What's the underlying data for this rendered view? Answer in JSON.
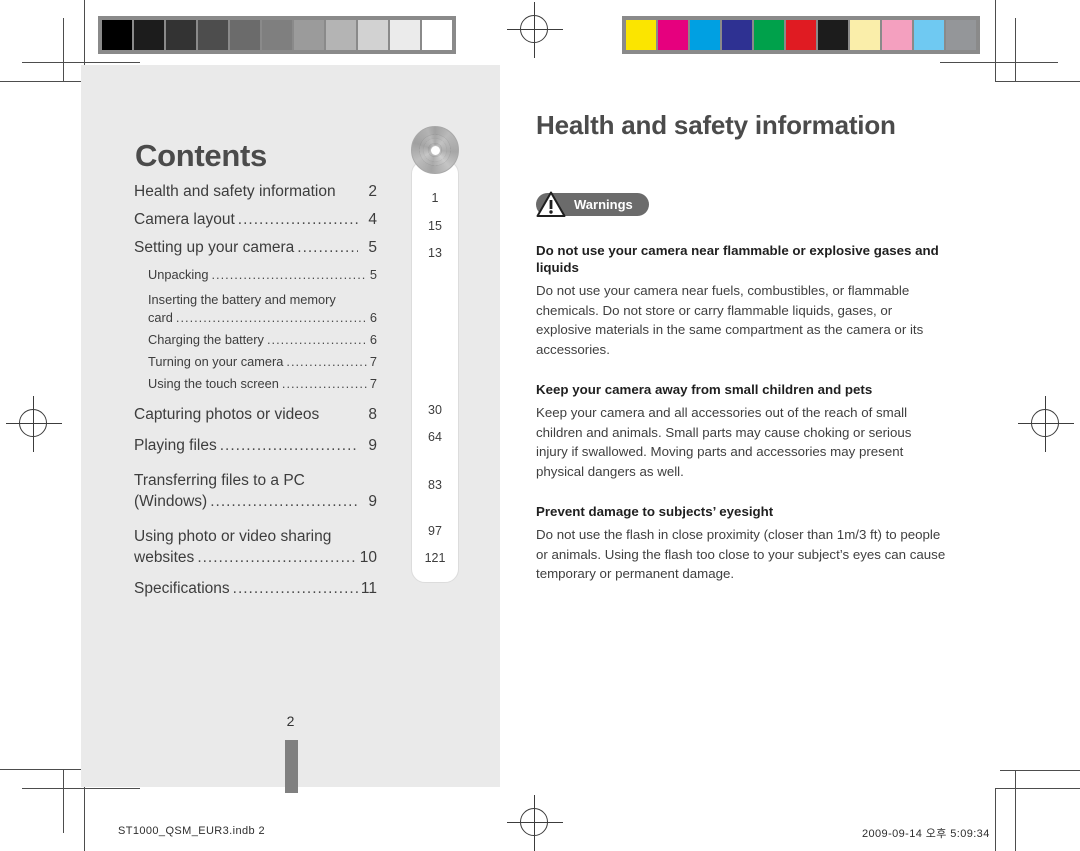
{
  "document": {
    "left_page": {
      "title": "Contents",
      "page_number": "2",
      "toc": [
        {
          "label": "Health and safety information",
          "page": "2",
          "level": 1,
          "dots": false
        },
        {
          "label": "Camera layout",
          "page": "4",
          "level": 1,
          "dots": true
        },
        {
          "label": "Setting up your camera",
          "page": "5",
          "level": 1,
          "dots": true
        },
        {
          "label": "Unpacking",
          "page": "5",
          "level": 2,
          "dots": true
        },
        {
          "label": "Inserting the battery and memory card",
          "page": "6",
          "level": 2,
          "dots": true,
          "wrap": true
        },
        {
          "label": "Charging the battery",
          "page": "6",
          "level": 2,
          "dots": true
        },
        {
          "label": "Turning on your camera",
          "page": "7",
          "level": 2,
          "dots": true
        },
        {
          "label": "Using the touch screen",
          "page": "7",
          "level": 2,
          "dots": true
        },
        {
          "label": "Capturing photos or videos",
          "page": "8",
          "level": 1,
          "dots": false
        },
        {
          "label": "Playing files",
          "page": "9",
          "level": 1,
          "dots": true
        },
        {
          "label": "Transferring files to a PC (Windows)",
          "page": "9",
          "level": 1,
          "dots": true,
          "wrap": true
        },
        {
          "label": "Using photo or video sharing websites",
          "page": "10",
          "level": 1,
          "dots": true,
          "wrap": true
        },
        {
          "label": "Specifications",
          "page": "11",
          "level": 1,
          "dots": true
        }
      ],
      "toc_lines": {
        "l1_label": "Health and safety information",
        "l1_page": "2",
        "l2_label": "Camera layout",
        "l2_page": "4",
        "l3_label": "Setting up your camera",
        "l3_page": "5",
        "l4_label": "Unpacking",
        "l4_page": "5",
        "l5_label_a": "Inserting the battery and memory",
        "l5_label_b": "card",
        "l5_page": "6",
        "l6_label": "Charging the battery",
        "l6_page": "6",
        "l7_label": "Turning on your camera",
        "l7_page": "7",
        "l8_label": "Using the touch screen",
        "l8_page": "7",
        "l9_label": "Capturing photos or videos",
        "l9_page": "8",
        "l10_label": "Playing files",
        "l10_page": "9",
        "l11_label_a": "Transferring files to a PC",
        "l11_label_b": "(Windows)",
        "l11_page": "9",
        "l12_label_a": "Using photo or video sharing",
        "l12_label_b": "websites",
        "l12_page": "10",
        "l13_label": "Specifications",
        "l13_page": "11",
        "dots": "...........................................................",
        "dots_long": "........................................................................"
      }
    },
    "disc_sidebar": {
      "icon": "cd-disc-icon",
      "numbers": [
        "1",
        "15",
        "13",
        "30",
        "64",
        "83",
        "97",
        "121"
      ],
      "n0": "1",
      "n1": "15",
      "n2": "13",
      "n3": "30",
      "n4": "64",
      "n5": "83",
      "n6": "97",
      "n7": "121"
    },
    "right_page": {
      "title": "Health and safety information",
      "badge": {
        "icon": "warning-triangle-icon",
        "label": "Warnings"
      },
      "sections": [
        {
          "heading": "Do not use your camera near flammable or explosive gases and liquids",
          "body": "Do not use your camera near fuels, combustibles, or flammable chemicals. Do not store or carry flammable liquids, gases, or explosive materials in the same compartment as the camera or its accessories."
        },
        {
          "heading": "Keep your camera away from small children and pets",
          "body": "Keep your camera and all accessories out of the reach of small children and animals. Small parts may cause choking or serious injury if swallowed. Moving parts and accessories may present physical dangers as well."
        },
        {
          "heading": "Prevent damage to subjects’ eyesight",
          "body": "Do not use the flash in close proximity (closer than 1m/3 ft) to people or animals. Using the flash too close to your subject’s eyes can cause temporary or permanent damage."
        }
      ],
      "s0_head": "Do not use your camera near flammable or explosive gases and liquids",
      "s0_body": "Do not use your camera near fuels, combustibles, or flammable chemicals. Do not store or carry flammable liquids, gases, or explosive materials in the same compartment as the camera or its accessories.",
      "s1_head": "Keep your camera away from small children and pets",
      "s1_body": "Keep your camera and all accessories out of the reach of small children and animals. Small parts may cause choking or serious injury if swallowed. Moving parts and accessories may present physical dangers as well.",
      "s2_head": "Prevent damage to subjects’ eyesight",
      "s2_body": "Do not use the flash in close proximity (closer than 1m/3 ft) to people or animals. Using the flash too close to your subject’s eyes can cause temporary or permanent damage."
    },
    "footer": {
      "left": "ST1000_QSM_EUR3.indb   2",
      "right": "2009-09-14   오후 5:09:34"
    }
  },
  "calibration": {
    "grayscale_strip": [
      "#000000",
      "#1c1c1c",
      "#333333",
      "#4d4d4d",
      "#6b6b6b",
      "#7f7f7f",
      "#9b9b9b",
      "#b4b4b4",
      "#d2d2d2",
      "#ebebeb",
      "#ffffff"
    ],
    "color_strip": [
      "#fbe500",
      "#e6007e",
      "#00a0e2",
      "#2e3192",
      "#00a14b",
      "#e01b22",
      "#1c1c1c",
      "#faeeaa",
      "#f4a0bf",
      "#6fc9f2",
      "#949699"
    ]
  }
}
